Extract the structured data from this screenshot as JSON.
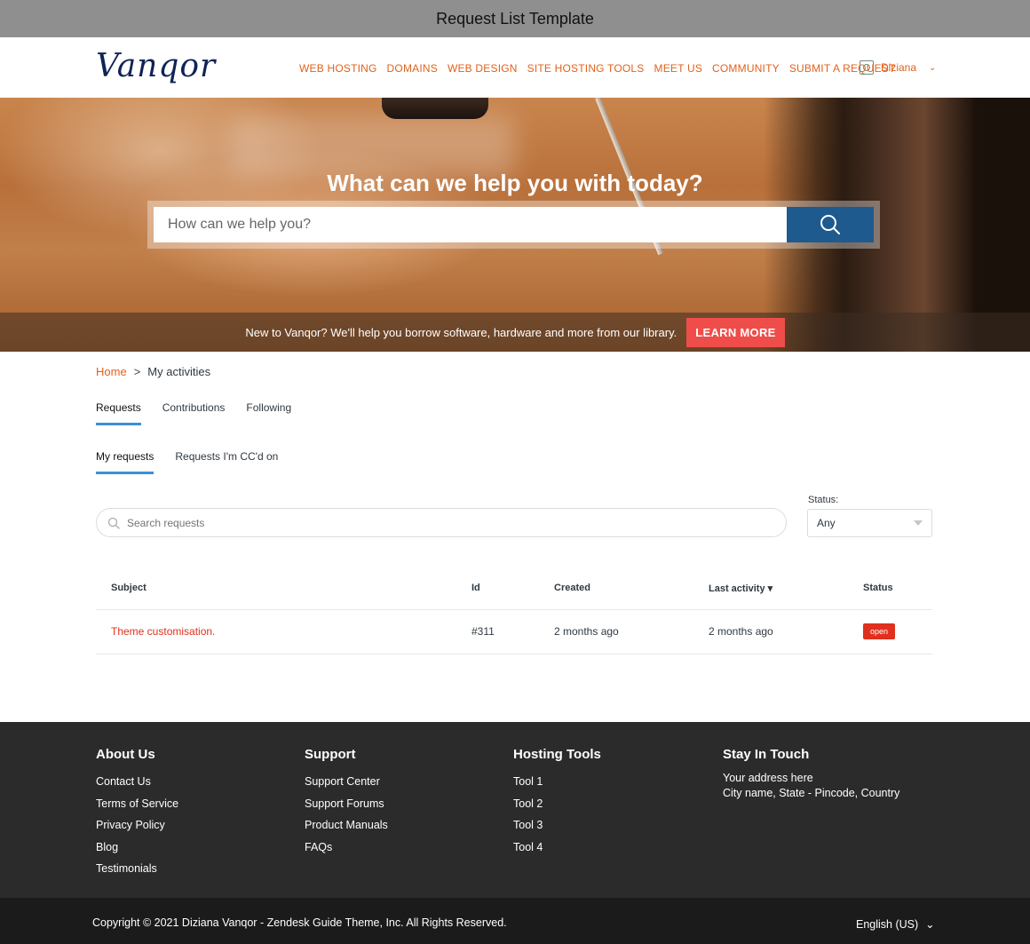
{
  "window": {
    "title": "Request List Template"
  },
  "header": {
    "logo": "Vanqor",
    "nav": [
      "WEB HOSTING",
      "DOMAINS",
      "WEB DESIGN",
      "SITE HOSTING TOOLS",
      "MEET US",
      "COMMUNITY",
      "SUBMIT A REQUEST"
    ],
    "user_name": "Diziana",
    "user_chevron": "⌄"
  },
  "hero": {
    "title": "What can we help you with today?",
    "search_placeholder": "How can we help you?",
    "banner_text": "New to Vanqor? We'll help you borrow software, hardware and more from our library.",
    "learn_more": "LEARN MORE"
  },
  "breadcrumb": {
    "home": "Home",
    "separator": ">",
    "current": "My activities"
  },
  "tabs": [
    {
      "label": "Requests",
      "active": true
    },
    {
      "label": "Contributions",
      "active": false
    },
    {
      "label": "Following",
      "active": false
    }
  ],
  "subtabs": [
    {
      "label": "My requests",
      "active": true
    },
    {
      "label": "Requests I'm CC'd on",
      "active": false
    }
  ],
  "filters": {
    "search_placeholder": "Search requests",
    "status_label": "Status:",
    "status_value": "Any"
  },
  "table": {
    "headers": {
      "subject": "Subject",
      "id": "Id",
      "created": "Created",
      "last_activity": "Last activity ▾",
      "status": "Status"
    },
    "rows": [
      {
        "subject": "Theme customisation.",
        "id": "#311",
        "created": "2 months ago",
        "last_activity": "2 months ago",
        "status": "open"
      }
    ]
  },
  "footer": {
    "about": {
      "title": "About Us",
      "links": [
        "Contact Us",
        "Terms of Service",
        "Privacy Policy",
        "Blog",
        "Testimonials"
      ]
    },
    "support": {
      "title": "Support",
      "links": [
        "Support Center",
        "Support Forums",
        "Product Manuals",
        "FAQs"
      ]
    },
    "tools": {
      "title": "Hosting Tools",
      "links": [
        "Tool 1",
        "Tool 2",
        "Tool 3",
        "Tool 4"
      ]
    },
    "touch": {
      "title": "Stay In Touch",
      "address1": "Your address here",
      "address2": "City name, State - Pincode, Country"
    },
    "copyright": "Copyright © 2021 Diziana Vanqor - Zendesk Guide Theme, Inc. All Rights Reserved.",
    "language": "English (US)",
    "language_chevron": "⌄"
  },
  "colors": {
    "accent": "#e2611b",
    "primary_button": "#1f5a8e",
    "learn_more": "#ef4d4a",
    "tab_underline": "#3b8fd9",
    "open_badge": "#e0301e",
    "footer_bg": "#2b2b2b"
  },
  "icons": {
    "search": "search-icon",
    "user": "user-icon",
    "dropdown": "dropdown-triangle-icon"
  }
}
